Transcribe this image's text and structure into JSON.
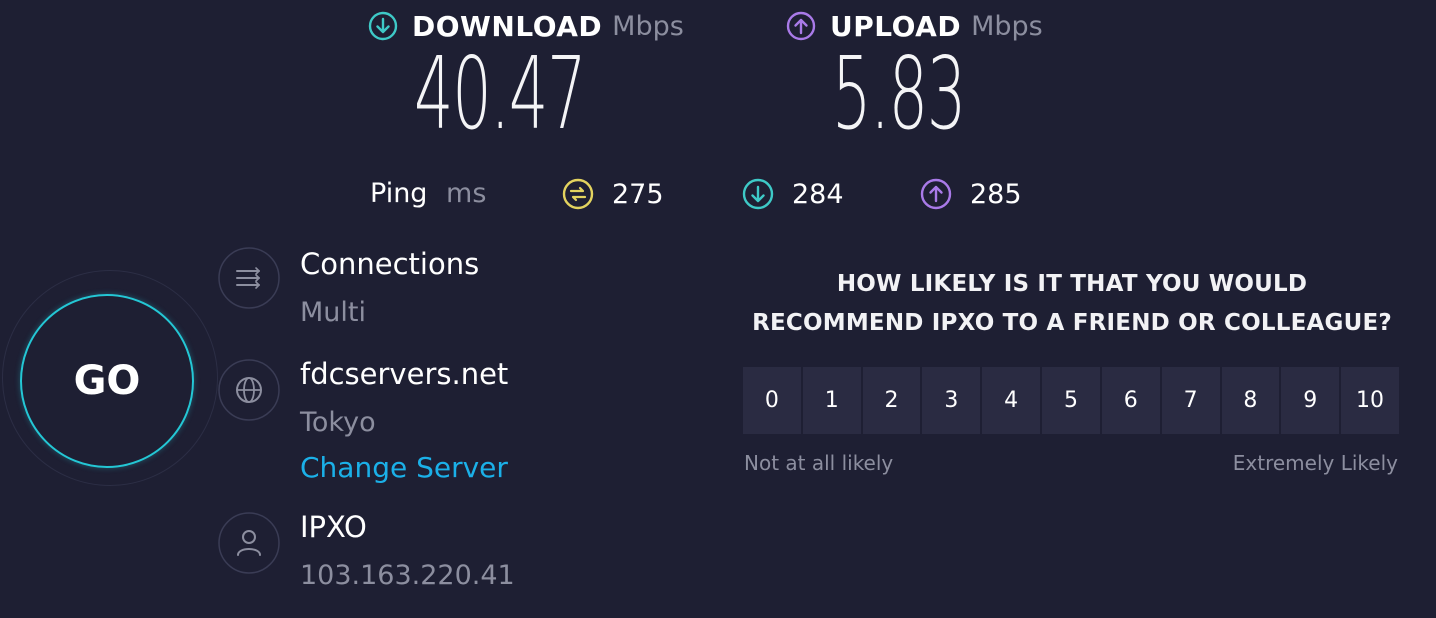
{
  "download": {
    "label": "DOWNLOAD",
    "unit": "Mbps",
    "value": "40.47",
    "icon": "arrow-down-circle-icon",
    "color": "#3ec9c7"
  },
  "upload": {
    "label": "UPLOAD",
    "unit": "Mbps",
    "value": "5.83",
    "icon": "arrow-up-circle-icon",
    "color": "#a97ae8"
  },
  "ping": {
    "label": "Ping",
    "unit": "ms",
    "idle": {
      "value": "275",
      "icon": "ping-idle-icon",
      "color": "#e3d35f"
    },
    "download": {
      "value": "284",
      "icon": "ping-download-icon",
      "color": "#3ec9c7"
    },
    "upload": {
      "value": "285",
      "icon": "ping-upload-icon",
      "color": "#a97ae8"
    }
  },
  "go_button": {
    "label": "GO",
    "color": "#24c7d5"
  },
  "connections": {
    "title": "Connections",
    "value": "Multi",
    "icon": "connections-icon"
  },
  "server": {
    "host": "fdcservers.net",
    "location": "Tokyo",
    "change_label": "Change Server",
    "icon": "globe-icon",
    "link_color": "#1bb0e8"
  },
  "provider": {
    "name": "IPXO",
    "ip": "103.163.220.41",
    "icon": "user-icon"
  },
  "survey": {
    "question_line1": "HOW LIKELY IS IT THAT YOU WOULD",
    "question_line2": "RECOMMEND IPXO TO A FRIEND OR COLLEAGUE?",
    "scale": [
      "0",
      "1",
      "2",
      "3",
      "4",
      "5",
      "6",
      "7",
      "8",
      "9",
      "10"
    ],
    "low_label": "Not at all likely",
    "high_label": "Extremely Likely"
  }
}
